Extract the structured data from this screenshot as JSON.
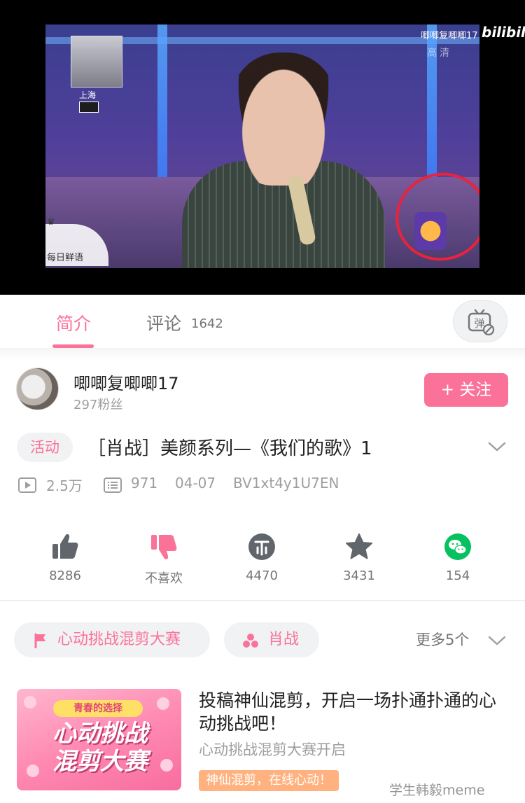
{
  "player": {
    "watermark_user": "唧唧复唧唧17",
    "watermark_brand": "bilibili",
    "quality_label": "高清",
    "pip_location": "上海",
    "left_logo_text": "每日鲜语"
  },
  "tabs": {
    "intro": "简介",
    "comments": "评论",
    "comments_count": "1642",
    "danmaku_icon_char": "弹"
  },
  "uploader": {
    "name": "唧唧复唧唧17",
    "fans": "297粉丝",
    "follow_label": "+ 关注"
  },
  "video": {
    "tag": "活动",
    "title": "［肖战］美颜系列—《我们的歌》1",
    "views": "2.5万",
    "danmaku_count": "971",
    "date": "04-07",
    "bvid": "BV1xt4y1U7EN"
  },
  "actions": [
    {
      "name": "like",
      "value": "8286"
    },
    {
      "name": "dislike",
      "value": "不喜欢"
    },
    {
      "name": "coin",
      "value": "4470"
    },
    {
      "name": "favorite",
      "value": "3431"
    },
    {
      "name": "share",
      "value": "154"
    }
  ],
  "topics": {
    "chip1": "心动挑战混剪大赛",
    "chip2": "肖战",
    "more": "更多5个"
  },
  "promo": {
    "image_banner": "青春的选择",
    "image_big": "心动挑战混剪大赛",
    "title": "投稿神仙混剪，开启一场扑通扑通的心动挑战吧！",
    "subtitle": "心动挑战混剪大赛开启",
    "badge": "神仙混剪，在线心动！"
  },
  "watermark": "学生韩毅meme",
  "colors": {
    "accent": "#fb7299",
    "wechat": "#07c160",
    "badge": "#ffb27f"
  }
}
